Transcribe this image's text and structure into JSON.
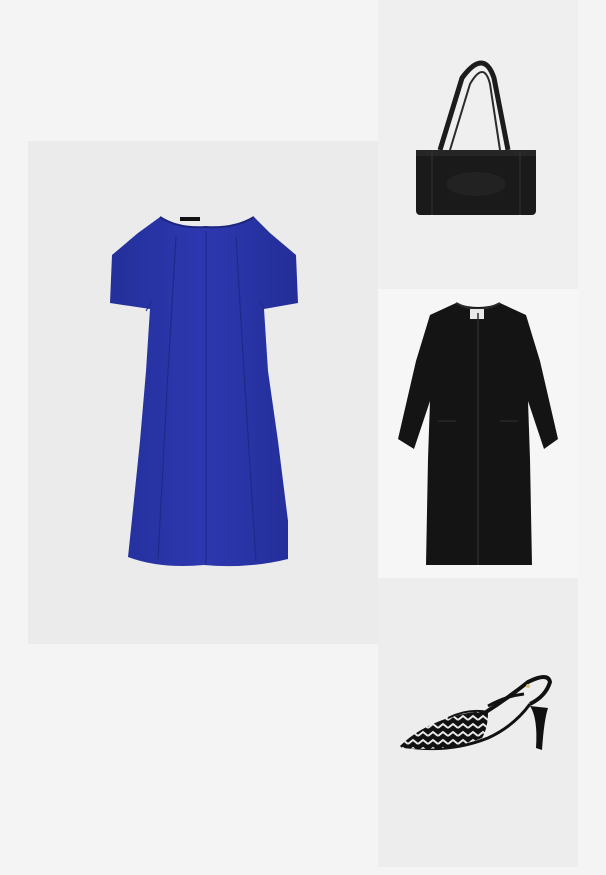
{
  "board": {
    "background": "#f4f4f4",
    "items": [
      {
        "name": "dress",
        "color": "#2a34a8",
        "panel_color": "#ebebeb"
      },
      {
        "name": "bag",
        "color": "#1a1a1a",
        "panel_color": "#efefef"
      },
      {
        "name": "coat",
        "color": "#141414",
        "panel_color": "#f6f6f6"
      },
      {
        "name": "shoe",
        "color": "#111111",
        "panel_color": "#ededed"
      }
    ]
  }
}
